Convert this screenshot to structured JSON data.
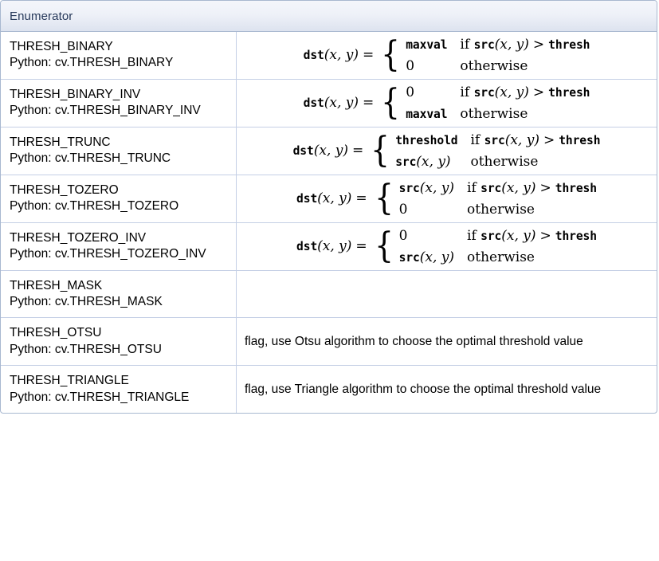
{
  "table": {
    "header": "Enumerator",
    "rows": [
      {
        "name": "THRESH_BINARY",
        "python": "Python: cv.THRESH_BINARY",
        "kind": "formula",
        "formula": {
          "lhs_fn": "dst",
          "lhs_args": "(x, y)",
          "equals": "=",
          "case1_value": "maxval",
          "case1_value_style": "tt",
          "case1_cond": "if",
          "case1_cond_fn": "src",
          "case1_cond_args": "(x, y)",
          "case1_cond_rel": ">",
          "case1_cond_rhs": "thresh",
          "case2_value": "0",
          "case2_value_style": "num",
          "case2_cond": "otherwise"
        },
        "description": ""
      },
      {
        "name": "THRESH_BINARY_INV",
        "python": "Python: cv.THRESH_BINARY_INV",
        "kind": "formula",
        "formula": {
          "lhs_fn": "dst",
          "lhs_args": "(x, y)",
          "equals": "=",
          "case1_value": "0",
          "case1_value_style": "num",
          "case1_cond": "if",
          "case1_cond_fn": "src",
          "case1_cond_args": "(x, y)",
          "case1_cond_rel": ">",
          "case1_cond_rhs": "thresh",
          "case2_value": "maxval",
          "case2_value_style": "tt",
          "case2_cond": "otherwise"
        },
        "description": ""
      },
      {
        "name": "THRESH_TRUNC",
        "python": "Python: cv.THRESH_TRUNC",
        "kind": "formula",
        "formula": {
          "lhs_fn": "dst",
          "lhs_args": "(x, y)",
          "equals": "=",
          "case1_value": "threshold",
          "case1_value_style": "tt",
          "case1_cond": "if",
          "case1_cond_fn": "src",
          "case1_cond_args": "(x, y)",
          "case1_cond_rel": ">",
          "case1_cond_rhs": "thresh",
          "case2_value": "src(x, y)",
          "case2_value_style": "fn",
          "case2_cond": "otherwise"
        },
        "description": ""
      },
      {
        "name": "THRESH_TOZERO",
        "python": "Python: cv.THRESH_TOZERO",
        "kind": "formula",
        "formula": {
          "lhs_fn": "dst",
          "lhs_args": "(x, y)",
          "equals": "=",
          "case1_value": "src(x, y)",
          "case1_value_style": "fn",
          "case1_cond": "if",
          "case1_cond_fn": "src",
          "case1_cond_args": "(x, y)",
          "case1_cond_rel": ">",
          "case1_cond_rhs": "thresh",
          "case2_value": "0",
          "case2_value_style": "num",
          "case2_cond": "otherwise"
        },
        "description": ""
      },
      {
        "name": "THRESH_TOZERO_INV",
        "python": "Python: cv.THRESH_TOZERO_INV",
        "kind": "formula",
        "formula": {
          "lhs_fn": "dst",
          "lhs_args": "(x, y)",
          "equals": "=",
          "case1_value": "0",
          "case1_value_style": "num",
          "case1_cond": "if",
          "case1_cond_fn": "src",
          "case1_cond_args": "(x, y)",
          "case1_cond_rel": ">",
          "case1_cond_rhs": "thresh",
          "case2_value": "src(x, y)",
          "case2_value_style": "fn",
          "case2_cond": "otherwise"
        },
        "description": ""
      },
      {
        "name": "THRESH_MASK",
        "python": "Python: cv.THRESH_MASK",
        "kind": "empty",
        "description": ""
      },
      {
        "name": "THRESH_OTSU",
        "python": "Python: cv.THRESH_OTSU",
        "kind": "text",
        "description": "flag, use Otsu algorithm to choose the optimal threshold value"
      },
      {
        "name": "THRESH_TRIANGLE",
        "python": "Python: cv.THRESH_TRIANGLE",
        "kind": "text",
        "description": "flag, use Triangle algorithm to choose the optimal threshold value"
      }
    ]
  },
  "colors": {
    "header_text": "#283a5b",
    "border": "#a8b8d0",
    "inner_border": "#c4cfe5",
    "body_text": "#000000"
  }
}
